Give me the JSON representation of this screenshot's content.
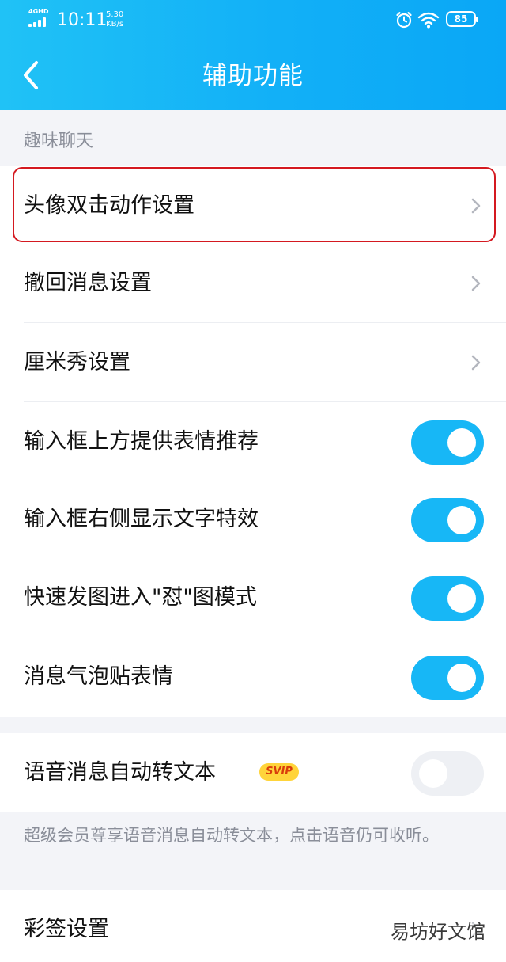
{
  "status": {
    "network": "4GHD",
    "time": "10:11",
    "speed_value": "5.30",
    "speed_unit": "KB/s",
    "battery": "85"
  },
  "header": {
    "title": "辅助功能",
    "background": "#12b0f7"
  },
  "section": {
    "title": "趣味聊天"
  },
  "rows": {
    "avatar_double_tap": "头像双击动作设置",
    "recall_message": "撤回消息设置",
    "cmshow": "厘米秀设置",
    "emoji_recommend": "输入框上方提供表情推荐",
    "text_effect": "输入框右侧显示文字特效",
    "quick_image": "快速发图进入\"怼\"图模式",
    "bubble_sticker": "消息气泡贴表情",
    "voice_to_text": "语音消息自动转文本",
    "color_sign": "彩签设置"
  },
  "toggles": {
    "emoji_recommend": "on",
    "text_effect": "on",
    "quick_image": "on",
    "bubble_sticker": "on",
    "voice_to_text": "off"
  },
  "badge": {
    "svip": "SVIP"
  },
  "note": "超级会员尊享语音消息自动转文本，点击语音仍可收听。",
  "watermark": "易坊好文馆",
  "colors": {
    "accent": "#17b7f6",
    "highlight": "#d41920",
    "svip_bg": "#ffd43a"
  },
  "icons": {
    "back": "chevron-left-icon",
    "chevron": "chevron-right-icon",
    "alarm": "alarm-icon",
    "wifi": "wifi-icon"
  }
}
